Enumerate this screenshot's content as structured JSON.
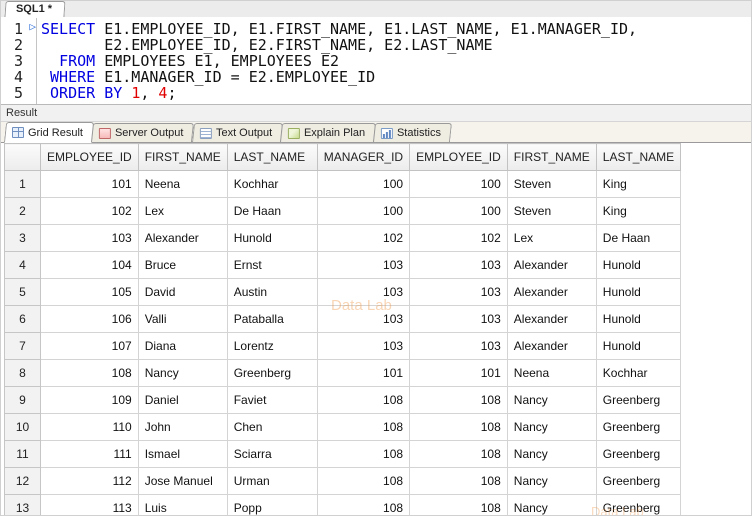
{
  "editor": {
    "tab_label": "SQL1 *",
    "lines": [
      {
        "num": "1",
        "marker": true,
        "segments": [
          {
            "t": "kw",
            "v": "SELECT "
          },
          {
            "t": "pl",
            "v": "E1.EMPLOYEE_ID, E1.FIRST_NAME, E1.LAST_NAME, E1.MANAGER_ID,"
          }
        ]
      },
      {
        "num": "2",
        "marker": false,
        "segments": [
          {
            "t": "pl",
            "v": "       E2.EMPLOYEE_ID, E2.FIRST_NAME, E2.LAST_NAME"
          }
        ]
      },
      {
        "num": "3",
        "marker": false,
        "segments": [
          {
            "t": "pl",
            "v": "  "
          },
          {
            "t": "kw",
            "v": "FROM "
          },
          {
            "t": "pl",
            "v": "EMPLOYEES E1, EMPLOYEES E2"
          }
        ]
      },
      {
        "num": "4",
        "marker": false,
        "segments": [
          {
            "t": "pl",
            "v": " "
          },
          {
            "t": "kw",
            "v": "WHERE "
          },
          {
            "t": "pl",
            "v": "E1.MANAGER_ID = E2.EMPLOYEE_ID"
          }
        ]
      },
      {
        "num": "5",
        "marker": false,
        "segments": [
          {
            "t": "pl",
            "v": " "
          },
          {
            "t": "kw",
            "v": "ORDER BY "
          },
          {
            "t": "num",
            "v": "1"
          },
          {
            "t": "pl",
            "v": ", "
          },
          {
            "t": "num",
            "v": "4"
          },
          {
            "t": "pl",
            "v": ";"
          }
        ]
      }
    ]
  },
  "result": {
    "label": "Result",
    "tabs": [
      {
        "label": "Grid Result",
        "icon": "grid-icon",
        "active": true
      },
      {
        "label": "Server Output",
        "icon": "server-icon",
        "active": false
      },
      {
        "label": "Text Output",
        "icon": "text-icon",
        "active": false
      },
      {
        "label": "Explain Plan",
        "icon": "plan-icon",
        "active": false
      },
      {
        "label": "Statistics",
        "icon": "stats-icon",
        "active": false
      }
    ]
  },
  "grid": {
    "columns": [
      "EMPLOYEE_ID",
      "FIRST_NAME",
      "LAST_NAME",
      "MANAGER_ID",
      "EMPLOYEE_ID",
      "FIRST_NAME",
      "LAST_NAME"
    ],
    "numeric_columns": [
      0,
      3,
      4
    ],
    "rows": [
      {
        "n": "1",
        "cells": [
          "101",
          "Neena",
          "Kochhar",
          "100",
          "100",
          "Steven",
          "King"
        ]
      },
      {
        "n": "2",
        "cells": [
          "102",
          "Lex",
          "De Haan",
          "100",
          "100",
          "Steven",
          "King"
        ]
      },
      {
        "n": "3",
        "cells": [
          "103",
          "Alexander",
          "Hunold",
          "102",
          "102",
          "Lex",
          "De Haan"
        ]
      },
      {
        "n": "4",
        "cells": [
          "104",
          "Bruce",
          "Ernst",
          "103",
          "103",
          "Alexander",
          "Hunold"
        ]
      },
      {
        "n": "5",
        "cells": [
          "105",
          "David",
          "Austin",
          "103",
          "103",
          "Alexander",
          "Hunold"
        ]
      },
      {
        "n": "6",
        "cells": [
          "106",
          "Valli",
          "Pataballa",
          "103",
          "103",
          "Alexander",
          "Hunold"
        ]
      },
      {
        "n": "7",
        "cells": [
          "107",
          "Diana",
          "Lorentz",
          "103",
          "103",
          "Alexander",
          "Hunold"
        ]
      },
      {
        "n": "8",
        "cells": [
          "108",
          "Nancy",
          "Greenberg",
          "101",
          "101",
          "Neena",
          "Kochhar"
        ]
      },
      {
        "n": "9",
        "cells": [
          "109",
          "Daniel",
          "Faviet",
          "108",
          "108",
          "Nancy",
          "Greenberg"
        ]
      },
      {
        "n": "10",
        "cells": [
          "110",
          "John",
          "Chen",
          "108",
          "108",
          "Nancy",
          "Greenberg"
        ]
      },
      {
        "n": "11",
        "cells": [
          "111",
          "Ismael",
          "Sciarra",
          "108",
          "108",
          "Nancy",
          "Greenberg"
        ]
      },
      {
        "n": "12",
        "cells": [
          "112",
          "Jose Manuel",
          "Urman",
          "108",
          "108",
          "Nancy",
          "Greenberg"
        ]
      },
      {
        "n": "13",
        "cells": [
          "113",
          "Luis",
          "Popp",
          "108",
          "108",
          "Nancy",
          "Greenberg"
        ]
      }
    ]
  },
  "watermark": {
    "text": "Data Lab"
  }
}
